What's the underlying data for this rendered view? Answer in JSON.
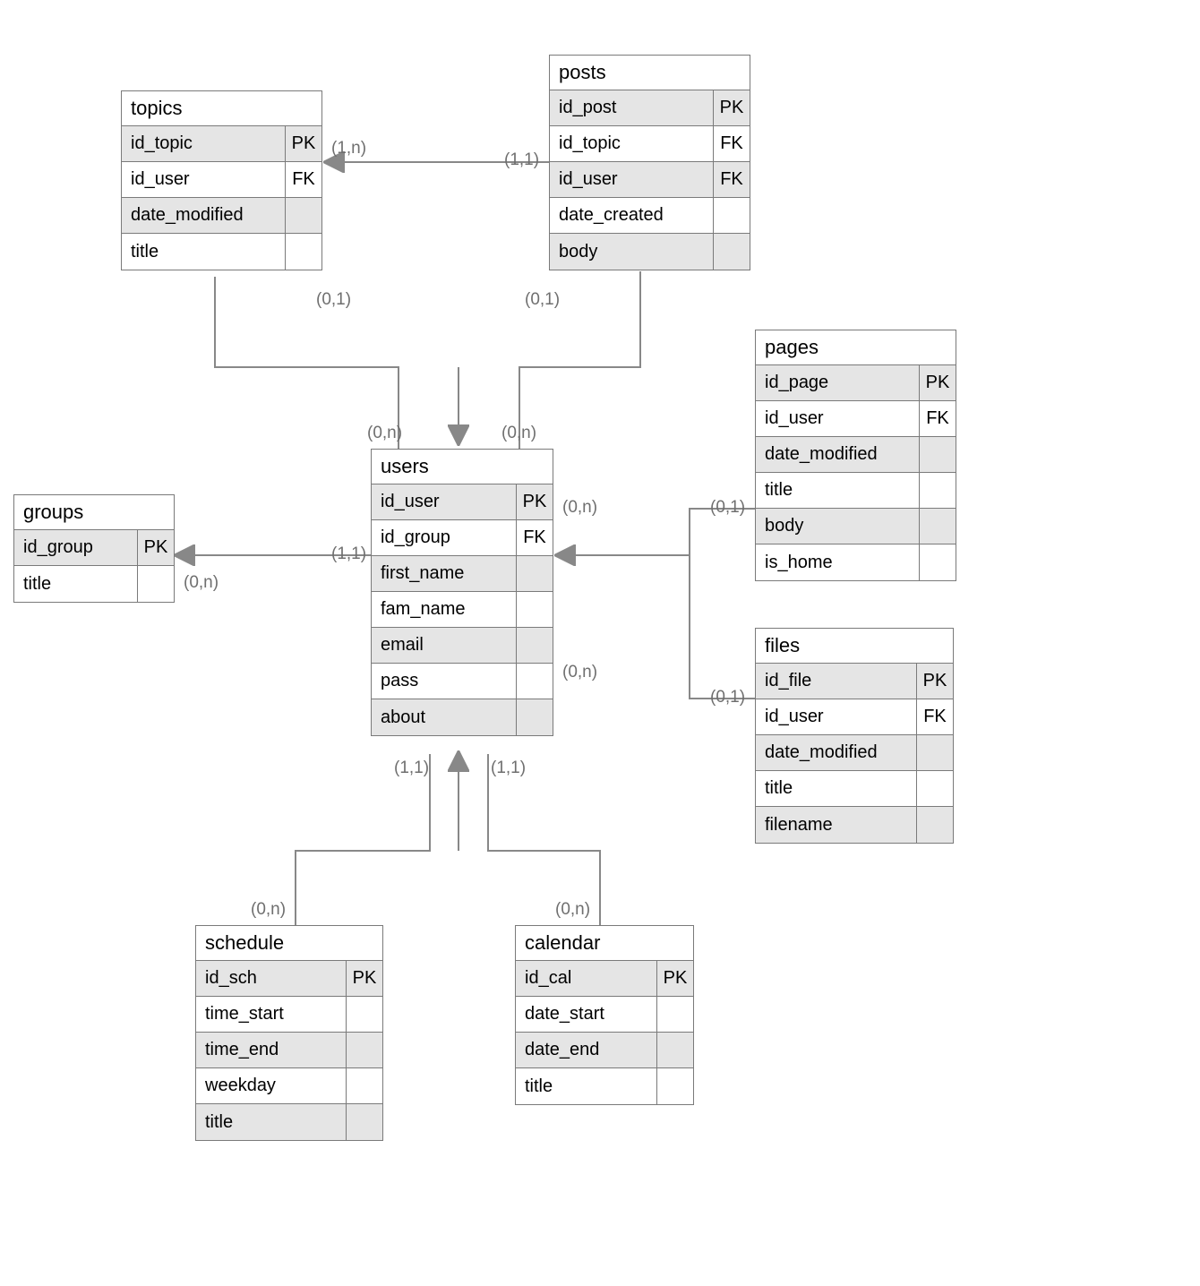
{
  "entities": {
    "topics": {
      "title": "topics",
      "rows": [
        {
          "name": "id_topic",
          "key": "PK"
        },
        {
          "name": "id_user",
          "key": "FK"
        },
        {
          "name": "date_modified",
          "key": ""
        },
        {
          "name": "title",
          "key": ""
        }
      ]
    },
    "posts": {
      "title": "posts",
      "rows": [
        {
          "name": "id_post",
          "key": "PK"
        },
        {
          "name": "id_topic",
          "key": "FK"
        },
        {
          "name": "id_user",
          "key": "FK"
        },
        {
          "name": "date_created",
          "key": ""
        },
        {
          "name": "body",
          "key": ""
        }
      ]
    },
    "users": {
      "title": "users",
      "rows": [
        {
          "name": "id_user",
          "key": "PK"
        },
        {
          "name": "id_group",
          "key": "FK"
        },
        {
          "name": "first_name",
          "key": ""
        },
        {
          "name": "fam_name",
          "key": ""
        },
        {
          "name": "email",
          "key": ""
        },
        {
          "name": "pass",
          "key": ""
        },
        {
          "name": "about",
          "key": ""
        }
      ]
    },
    "groups": {
      "title": "groups",
      "rows": [
        {
          "name": "id_group",
          "key": "PK"
        },
        {
          "name": "title",
          "key": ""
        }
      ]
    },
    "pages": {
      "title": "pages",
      "rows": [
        {
          "name": "id_page",
          "key": "PK"
        },
        {
          "name": "id_user",
          "key": "FK"
        },
        {
          "name": "date_modified",
          "key": ""
        },
        {
          "name": "title",
          "key": ""
        },
        {
          "name": "body",
          "key": ""
        },
        {
          "name": "is_home",
          "key": ""
        }
      ]
    },
    "files": {
      "title": "files",
      "rows": [
        {
          "name": "id_file",
          "key": "PK"
        },
        {
          "name": "id_user",
          "key": "FK"
        },
        {
          "name": "date_modified",
          "key": ""
        },
        {
          "name": "title",
          "key": ""
        },
        {
          "name": "filename",
          "key": ""
        }
      ]
    },
    "schedule": {
      "title": "schedule",
      "rows": [
        {
          "name": "id_sch",
          "key": "PK"
        },
        {
          "name": "time_start",
          "key": ""
        },
        {
          "name": "time_end",
          "key": ""
        },
        {
          "name": "weekday",
          "key": ""
        },
        {
          "name": "title",
          "key": ""
        }
      ]
    },
    "calendar": {
      "title": "calendar",
      "rows": [
        {
          "name": "id_cal",
          "key": "PK"
        },
        {
          "name": "date_start",
          "key": ""
        },
        {
          "name": "date_end",
          "key": ""
        },
        {
          "name": "title",
          "key": ""
        }
      ]
    }
  },
  "relationships": [
    {
      "from": "posts",
      "to": "topics",
      "from_card": "(1,1)",
      "to_card": "(1,n)"
    },
    {
      "from": "topics",
      "to": "users",
      "from_card": "(0,1)",
      "to_card": "(0,n)"
    },
    {
      "from": "posts",
      "to": "users",
      "from_card": "(0,1)",
      "to_card": "(0,n)"
    },
    {
      "from": "users",
      "to": "groups",
      "from_card": "(1,1)",
      "to_card": "(0,n)"
    },
    {
      "from": "pages",
      "to": "users",
      "from_card": "(0,1)",
      "to_card": "(0,n)"
    },
    {
      "from": "files",
      "to": "users",
      "from_card": "(0,1)",
      "to_card": "(0,n)"
    },
    {
      "from": "schedule",
      "to": "users",
      "from_card": "(0,n)",
      "to_card": "(1,1)"
    },
    {
      "from": "calendar",
      "to": "users",
      "from_card": "(0,n)",
      "to_card": "(1,1)"
    }
  ],
  "labels": {
    "l_posts_topics_from": "(1,1)",
    "l_posts_topics_to": "(1,n)",
    "l_topics_users_from": "(0,1)",
    "l_posts_users_from": "(0,1)",
    "l_users_top_left": "(0,n)",
    "l_users_top_right": "(0,n)",
    "l_users_groups_from": "(1,1)",
    "l_users_groups_to": "(0,n)",
    "l_users_right_top": "(0,n)",
    "l_users_right_bot": "(0,n)",
    "l_pages_from": "(0,1)",
    "l_files_from": "(0,1)",
    "l_users_bottom_left": "(1,1)",
    "l_users_bottom_right": "(1,1)",
    "l_schedule_from": "(0,n)",
    "l_calendar_from": "(0,n)"
  }
}
